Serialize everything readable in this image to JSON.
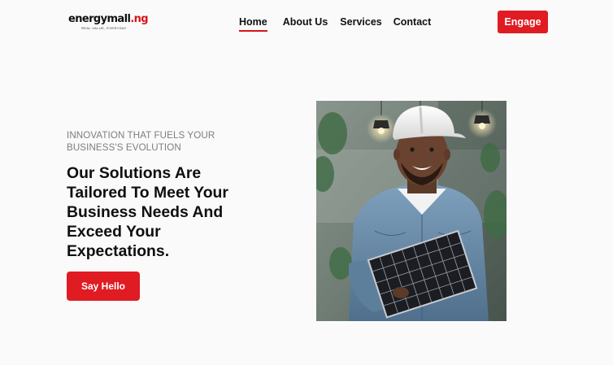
{
  "header": {
    "logo": {
      "main": "energymall",
      "tld": ".ng",
      "tagline": "REAL VALUE, EVERYDAY"
    },
    "nav": [
      {
        "label": "Home",
        "active": true
      },
      {
        "label": "About Us",
        "active": false
      },
      {
        "label": "Services",
        "active": false
      },
      {
        "label": "Contact",
        "active": false
      }
    ],
    "cta_label": "Engage"
  },
  "hero": {
    "eyebrow": "INNOVATION THAT FUELS YOUR BUSINESS'S EVOLUTION",
    "headline": "Our Solutions Are Tailored To Meet Your Business Needs And Exceed Your Expectations.",
    "button_label": "Say Hello",
    "image_subject": "smiling engineer in white hard hat and denim shirt holding a solar panel"
  },
  "colors": {
    "accent": "#e01b22",
    "background": "#fafafa",
    "text": "#111111",
    "muted": "#7d7d7d"
  }
}
